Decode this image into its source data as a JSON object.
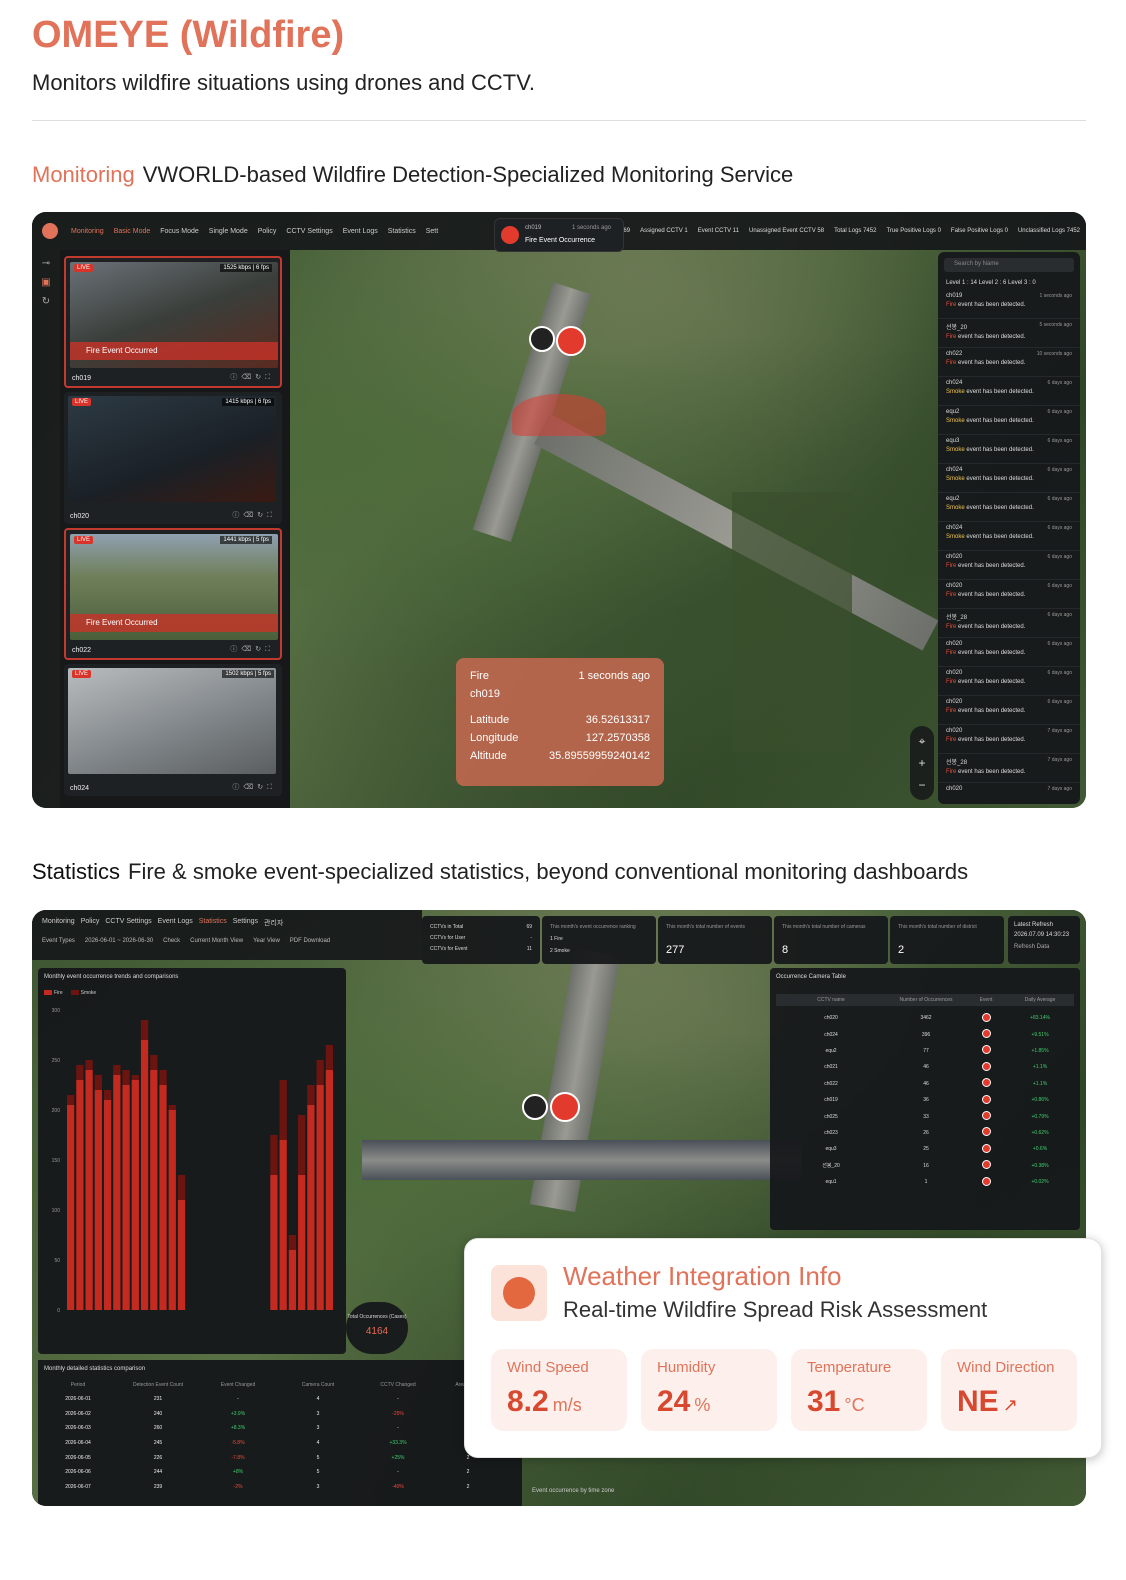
{
  "title": "OMEYE (Wildfire)",
  "subtitle": "Monitors wildfire situations using drones and CCTV.",
  "monitoring": {
    "key": "Monitoring",
    "desc": "VWORLD-based Wildfire Detection-Specialized Monitoring Service",
    "nav": [
      "Monitoring",
      "Basic Mode",
      "Focus Mode",
      "Single Mode",
      "Policy",
      "CCTV Settings",
      "Event Logs",
      "Statistics",
      "Sett"
    ],
    "stats": [
      "CCTV 69",
      "Assigned CCTV 1",
      "Event CCTV 11",
      "Unassigned Event CCTV 58",
      "Total Logs 7452",
      "True Positive Logs 0",
      "False Positive Logs 0",
      "Unclassified Logs 7452"
    ],
    "notification": {
      "camera": "ch019",
      "time": "1 seconds ago",
      "message": "Fire Event Occurrence"
    },
    "cameras": [
      {
        "name": "ch019",
        "live": "LIVE",
        "bitrate": "1525 kbps | 6 fps",
        "banner": "Fire Event Occurred"
      },
      {
        "name": "ch020",
        "live": "LIVE",
        "bitrate": "1415 kbps | 6 fps",
        "banner": ""
      },
      {
        "name": "ch022",
        "live": "LIVE",
        "bitrate": "1441 kbps | 5 fps",
        "banner": "Fire Event Occurred"
      },
      {
        "name": "ch024",
        "live": "LIVE",
        "bitrate": "1502 kbps | 5 fps",
        "banner": ""
      }
    ],
    "search_placeholder": "Search by Name",
    "levels": "Level 1 : 14   Level 2 : 6   Level 3 : 0",
    "events": [
      {
        "name": "ch019",
        "time": "1 seconds ago",
        "kind": "Fire",
        "text": " event has been detected."
      },
      {
        "name": "선봉_20",
        "time": "5 seconds ago",
        "kind": "Fire",
        "text": " event has been detected."
      },
      {
        "name": "ch022",
        "time": "10 seconds ago",
        "kind": "Fire",
        "text": " event has been detected."
      },
      {
        "name": "ch024",
        "time": "6 days ago",
        "kind": "Smoke",
        "text": " event has been detected."
      },
      {
        "name": "equ2",
        "time": "6 days ago",
        "kind": "Smoke",
        "text": " event has been detected."
      },
      {
        "name": "equ3",
        "time": "6 days ago",
        "kind": "Smoke",
        "text": " event has been detected."
      },
      {
        "name": "ch024",
        "time": "6 days ago",
        "kind": "Smoke",
        "text": " event has been detected."
      },
      {
        "name": "equ2",
        "time": "6 days ago",
        "kind": "Smoke",
        "text": " event has been detected."
      },
      {
        "name": "ch024",
        "time": "6 days ago",
        "kind": "Smoke",
        "text": " event has been detected."
      },
      {
        "name": "ch020",
        "time": "6 days ago",
        "kind": "Fire",
        "text": " event has been detected."
      },
      {
        "name": "ch020",
        "time": "6 days ago",
        "kind": "Fire",
        "text": " event has been detected."
      },
      {
        "name": "선봉_28",
        "time": "6 days ago",
        "kind": "Fire",
        "text": " event has been detected."
      },
      {
        "name": "ch020",
        "time": "6 days ago",
        "kind": "Fire",
        "text": " event has been detected."
      },
      {
        "name": "ch020",
        "time": "6 days ago",
        "kind": "Fire",
        "text": " event has been detected."
      },
      {
        "name": "ch020",
        "time": "6 days ago",
        "kind": "Fire",
        "text": " event has been detected."
      },
      {
        "name": "ch020",
        "time": "7 days ago",
        "kind": "Fire",
        "text": " event has been detected."
      },
      {
        "name": "선봉_28",
        "time": "7 days ago",
        "kind": "Fire",
        "text": " event has been detected."
      },
      {
        "name": "ch020",
        "time": "7 days ago",
        "kind": "",
        "text": ""
      }
    ],
    "popup": {
      "type": "Fire",
      "time": "1 seconds ago",
      "camera": "ch019",
      "lat_label": "Latitude",
      "lat": "36.52613317",
      "lon_label": "Longitude",
      "lon": "127.2570358",
      "alt_label": "Altitude",
      "alt": "35.89559959240142"
    }
  },
  "statistics": {
    "key": "Statistics",
    "desc": "Fire & smoke event-specialized statistics, beyond conventional monitoring dashboards",
    "nav": [
      "Monitoring",
      "Policy",
      "CCTV Settings",
      "Event Logs",
      "Statistics",
      "Settings",
      "관리자"
    ],
    "filters": [
      "Event Types",
      "2026-06-01 ~ 2026-06-30",
      "Check",
      "Current Month View",
      "Year View",
      "PDF Download"
    ],
    "cctv_counts": [
      {
        "l": "CCTVs in Total",
        "v": "69"
      },
      {
        "l": "CCTVs for User",
        "v": "-"
      },
      {
        "l": "CCTVs for Event",
        "v": "11"
      }
    ],
    "ranking_label": "This month's event occurrence ranking",
    "ranking": [
      "1   Fire",
      "2   Smoke"
    ],
    "kpis": [
      {
        "l": "This month's total number of events",
        "v": "277"
      },
      {
        "l": "This month's total number of cameras",
        "v": "8"
      },
      {
        "l": "This month's total number of district",
        "v": "2"
      }
    ],
    "refresh": {
      "label": "Latest Refresh",
      "time": "2026.07.09 14:30:23",
      "button": "Refresh Data"
    },
    "chart_title": "Monthly event occurrence trends and comparisons",
    "legend": [
      "Fire",
      "Smoke"
    ],
    "total_label": "Total Occurrences (Cases)",
    "total_value": "4164",
    "occ_title": "Occurrence Camera Table",
    "occ_head": [
      "CCTV name",
      "Number of Occurrences",
      "Event",
      "Daily Average"
    ],
    "occ_rows": [
      [
        "ch020",
        "3462",
        "+83.14%"
      ],
      [
        "ch024",
        "396",
        "+9.51%"
      ],
      [
        "equ2",
        "77",
        "+1.85%"
      ],
      [
        "ch021",
        "46",
        "+1.1%"
      ],
      [
        "ch022",
        "46",
        "+1.1%"
      ],
      [
        "ch019",
        "36",
        "+0.86%"
      ],
      [
        "ch025",
        "33",
        "+0.79%"
      ],
      [
        "ch023",
        "26",
        "+0.62%"
      ],
      [
        "equ3",
        "25",
        "+0.6%"
      ],
      [
        "선봉_20",
        "16",
        "+0.38%"
      ],
      [
        "equ1",
        "1",
        "+0.02%"
      ]
    ],
    "detail_title": "Monthly detailed statistics comparison",
    "detail_head": [
      "Period",
      "Detection Event Count",
      "Event Changed",
      "Camera Count",
      "CCTV Changed",
      "Area Count"
    ],
    "detail_rows": [
      [
        "2026-06-01",
        "231",
        "-",
        "4",
        "-",
        "2"
      ],
      [
        "2026-06-02",
        "240",
        "+3.9%",
        "3",
        "-25%",
        "1"
      ],
      [
        "2026-06-03",
        "260",
        "+8.3%",
        "3",
        "-",
        "1"
      ],
      [
        "2026-06-04",
        "245",
        "-5.8%",
        "4",
        "+33.3%",
        "2"
      ],
      [
        "2026-06-05",
        "226",
        "-7.8%",
        "5",
        "+25%",
        "2"
      ],
      [
        "2026-06-06",
        "244",
        "+8%",
        "5",
        "-",
        "2"
      ],
      [
        "2026-06-07",
        "239",
        "-2%",
        "3",
        "-40%",
        "2"
      ]
    ],
    "tz_label": "Event occurrence by time zone"
  },
  "chart_data": {
    "type": "bar",
    "title": "Monthly event occurrence trends and comparisons",
    "ylim": [
      0,
      300
    ],
    "yticks": [
      0,
      50,
      100,
      150,
      200,
      250,
      300
    ],
    "series": [
      {
        "name": "Fire",
        "values": [
          205,
          230,
          240,
          220,
          210,
          235,
          225,
          230,
          270,
          240,
          225,
          200,
          110,
          0,
          0,
          0,
          0,
          0,
          0,
          0,
          0,
          0,
          135,
          170,
          60,
          135,
          205,
          225,
          240
        ]
      },
      {
        "name": "Smoke",
        "values": [
          10,
          15,
          10,
          15,
          10,
          10,
          15,
          5,
          20,
          15,
          15,
          5,
          25,
          0,
          0,
          0,
          0,
          0,
          0,
          0,
          0,
          0,
          40,
          60,
          15,
          60,
          20,
          25,
          25
        ]
      }
    ],
    "colors": {
      "Fire": "#c42a20",
      "Smoke": "#6b1410"
    }
  },
  "weather": {
    "title": "Weather Integration Info",
    "subtitle": "Real-time Wildfire Spread Risk Assessment",
    "cards": [
      {
        "label": "Wind Speed",
        "value": "8.2",
        "unit": "m/s"
      },
      {
        "label": "Humidity",
        "value": "24",
        "unit": "%"
      },
      {
        "label": "Temperature",
        "value": "31",
        "unit": "°C"
      },
      {
        "label": "Wind Direction",
        "value": "NE",
        "unit": "↗"
      }
    ]
  }
}
